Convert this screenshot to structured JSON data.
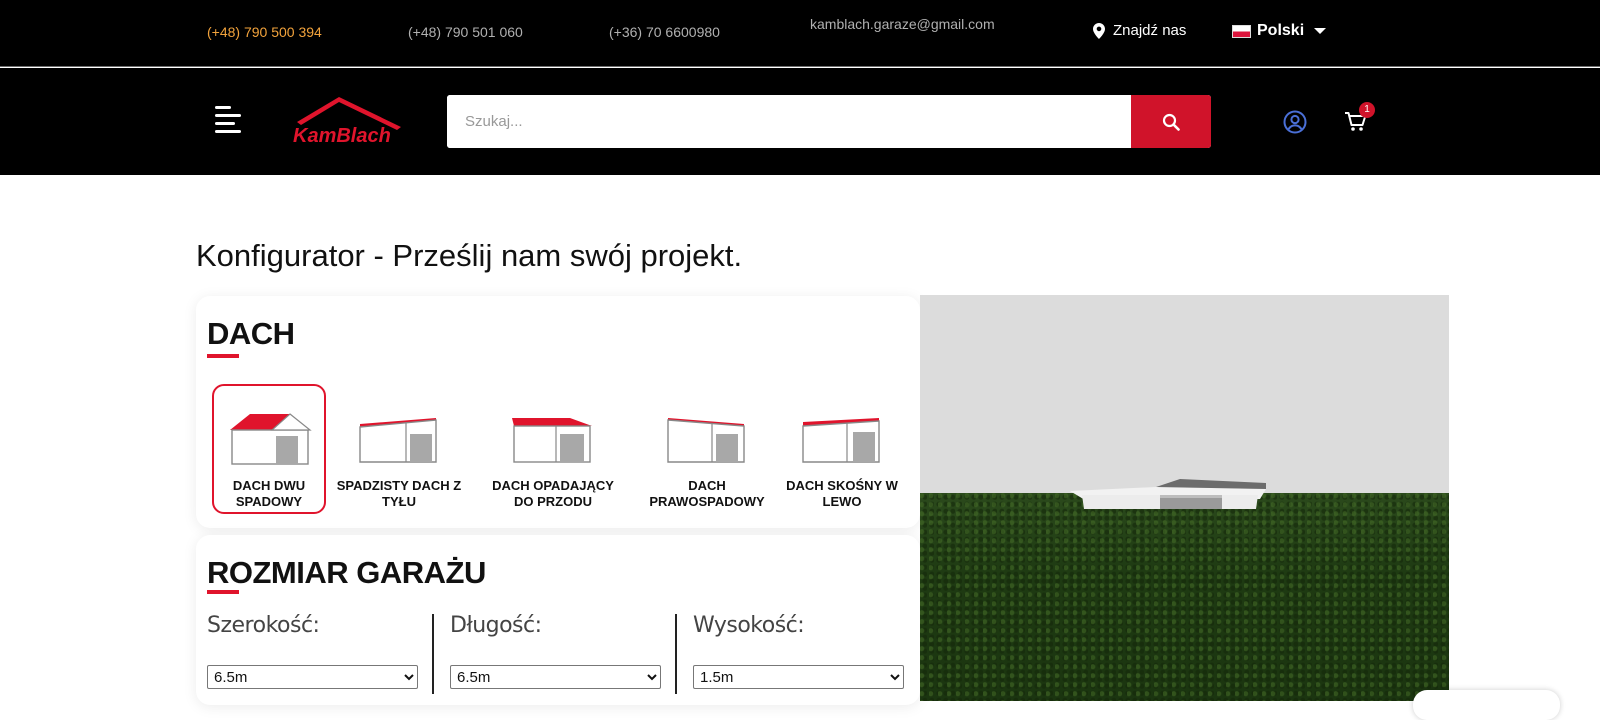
{
  "topbar": {
    "phone_1": "(+48) 790 500 394",
    "phone_2": "(+48) 790 501 060",
    "phone_3": "(+36) 70 6600980",
    "email": "kamblach.garaze@gmail.com",
    "find_us": "Znajdź nas",
    "language": "Polski"
  },
  "header": {
    "logo_text": "KamBlach",
    "search_placeholder": "Szukaj...",
    "cart_count": "1"
  },
  "main": {
    "title": "Konfigurator - Prześlij nam swój projekt."
  },
  "roof": {
    "section_title": "DACH",
    "options": [
      {
        "label": "DACH DWU SPADOWY",
        "selected": true
      },
      {
        "label": "SPADZISTY DACH Z TYŁU",
        "selected": false
      },
      {
        "label": "DACH OPADAJĄCY DO PRZODU",
        "selected": false
      },
      {
        "label": "DACH PRAWOSPADOWY",
        "selected": false
      },
      {
        "label": "DACH SKOŚNY W LEWO",
        "selected": false
      }
    ]
  },
  "size": {
    "section_title": "ROZMIAR GARAŻU",
    "width_label": "Szerokość:",
    "width_value": "6.5m",
    "length_label": "Długość:",
    "length_value": "6.5m",
    "height_label": "Wysokość:",
    "height_value": "1.5m"
  },
  "colors": {
    "accent": "#e0142c",
    "phone_highlight": "#f2a33c",
    "user_icon": "#4a6fd6"
  },
  "icons": [
    "map-pin-icon",
    "flag-pl-icon",
    "chevron-down-icon",
    "menu-icon",
    "search-icon",
    "user-circle-icon",
    "cart-icon"
  ]
}
